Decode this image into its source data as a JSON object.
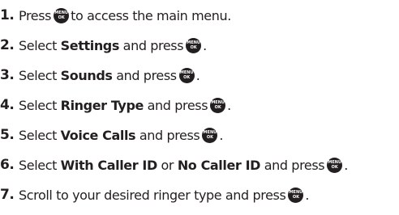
{
  "key": {
    "line1": "MENU",
    "line2": "OK"
  },
  "steps": [
    {
      "num": "1.",
      "a": "Press",
      "b": "to access the main menu."
    },
    {
      "num": "2.",
      "a": "Select",
      "bold1": "Settings",
      "b": "and press",
      "end": "."
    },
    {
      "num": "3.",
      "a": "Select",
      "bold1": "Sounds",
      "b": "and press",
      "end": "."
    },
    {
      "num": "4.",
      "a": "Select",
      "bold1": "Ringer Type",
      "b": "and press",
      "end": "."
    },
    {
      "num": "5.",
      "a": "Select",
      "bold1": "Voice Calls",
      "b": "and press",
      "end": "."
    },
    {
      "num": "6.",
      "a": "Select",
      "bold1": "With Caller ID",
      "mid": "or",
      "bold2": "No Caller ID",
      "b": "and press",
      "end": "."
    },
    {
      "num": "7.",
      "a": "Scroll to your desired ringer type and press",
      "end": "."
    }
  ]
}
